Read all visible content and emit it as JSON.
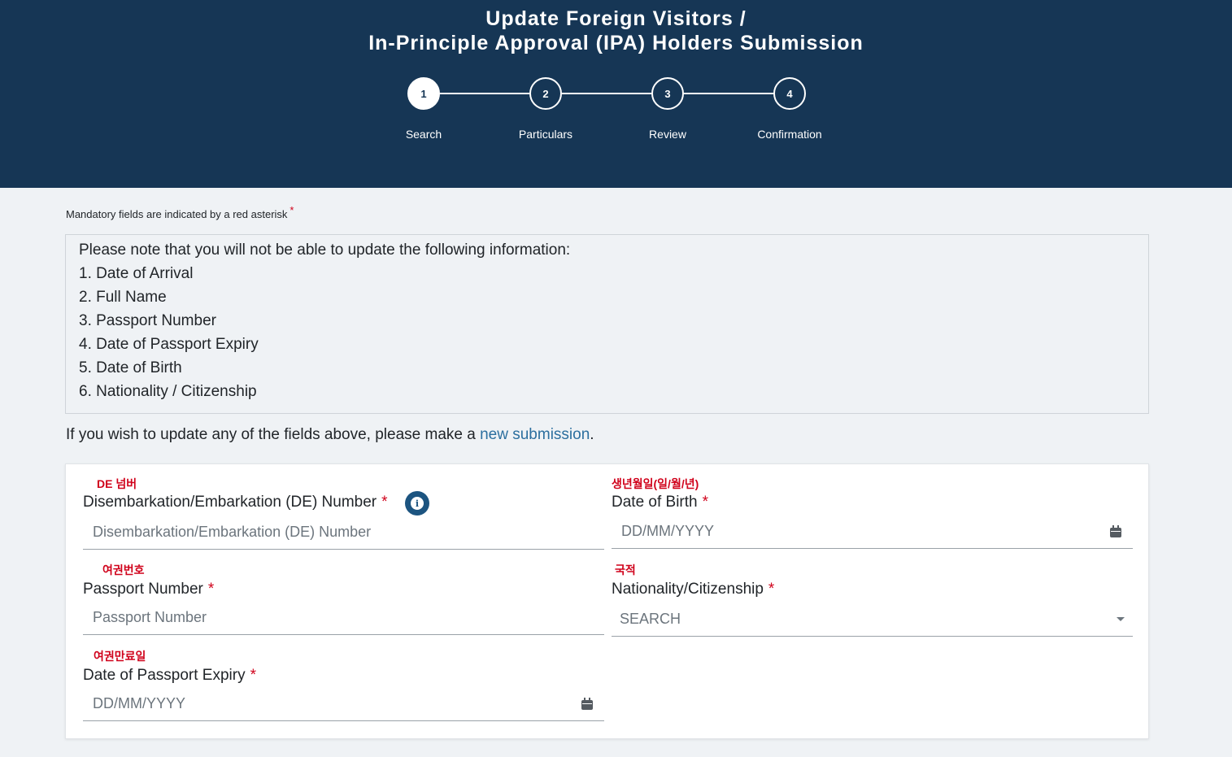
{
  "header": {
    "title_line1": "Update Foreign Visitors /",
    "title_line2": "In-Principle Approval (IPA) Holders Submission"
  },
  "stepper": {
    "current_step": 1,
    "steps": [
      {
        "number": "1",
        "label": "Search"
      },
      {
        "number": "2",
        "label": "Particulars"
      },
      {
        "number": "3",
        "label": "Review"
      },
      {
        "number": "4",
        "label": "Confirmation"
      }
    ]
  },
  "mandatory_note": "Mandatory fields are indicated by a red asterisk",
  "asterisk": "*",
  "notice": {
    "intro": "Please note that you will not be able to update the following information:",
    "items": [
      "1. Date of Arrival",
      "2. Full Name",
      "3. Passport Number",
      "4. Date of Passport Expiry",
      "5. Date of Birth",
      "6. Nationality / Citizenship"
    ]
  },
  "update_prompt": {
    "text_before": "If you wish to update any of the fields above, please make a ",
    "link_text": "new submission",
    "text_after": "."
  },
  "form": {
    "de_number": {
      "annotation": "DE 넘버",
      "label": "Disembarkation/Embarkation (DE) Number",
      "placeholder": "Disembarkation/Embarkation (DE) Number",
      "info_icon_glyph": "i"
    },
    "date_of_birth": {
      "annotation": "생년월일(일/월/년)",
      "label": "Date of Birth",
      "placeholder": "DD/MM/YYYY"
    },
    "passport_number": {
      "annotation": "여권번호",
      "label": "Passport Number",
      "placeholder": "Passport Number"
    },
    "nationality": {
      "annotation": "국적",
      "label": "Nationality/Citizenship",
      "placeholder": "SEARCH"
    },
    "passport_expiry": {
      "annotation": "여권만료일",
      "label": "Date of Passport Expiry",
      "placeholder": "DD/MM/YYYY"
    }
  },
  "colors": {
    "header_bg": "#163655",
    "page_bg": "#eff2f5",
    "required_red": "#d0021b",
    "link_blue": "#2c6f9f",
    "info_icon_blue": "#1c5480"
  },
  "icons": [
    "info-icon",
    "calendar-icon",
    "chevron-down-icon"
  ]
}
